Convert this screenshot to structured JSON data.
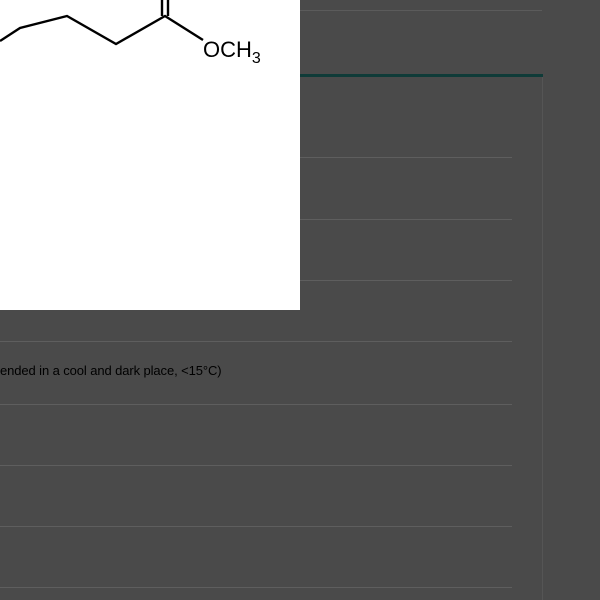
{
  "structure": {
    "group_label": "OCH",
    "group_subscript": "3"
  },
  "specs": {
    "storage_text": "ended in a cool and dark place, <15°C)"
  }
}
